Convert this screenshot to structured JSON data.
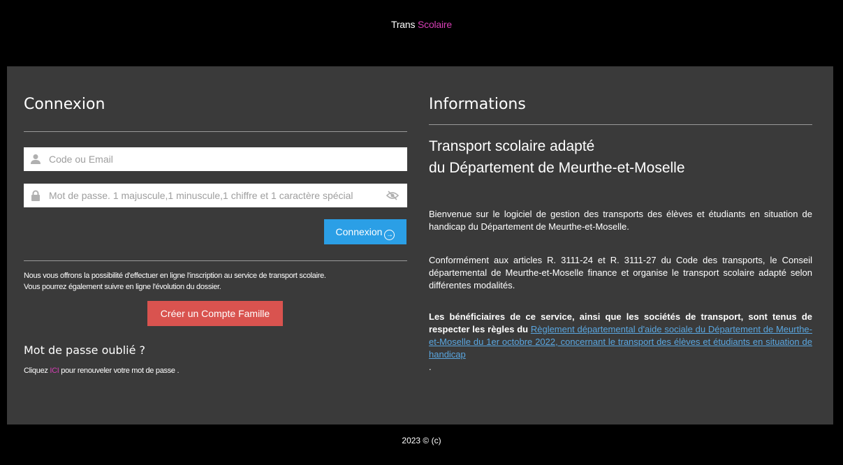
{
  "brand": {
    "word1": "Trans",
    "word2": "Scolaire"
  },
  "login": {
    "heading": "Connexion",
    "code_placeholder": "Code ou Email",
    "password_placeholder": "Mot de passe. 1 majuscule,1 minuscule,1 chiffre et 1 caractère spécial",
    "submit_label": "Connexion",
    "info_line1": "Nous vous offrons la possibilité d'effectuer en ligne l'inscription au service de transport scolaire.",
    "info_line2": "Vous pourrez également suivre en ligne l'évolution du dossier.",
    "create_account_label": "Créer un Compte Famille",
    "forgot_heading": "Mot de passe oublié ?",
    "forgot_prefix": "Cliquez",
    "forgot_link": "ICI",
    "forgot_suffix": "pour renouveler votre mot de passe ."
  },
  "info": {
    "heading": "Informations",
    "title_line1": "Transport scolaire adapté",
    "title_line2": "du Département de Meurthe-et-Moselle",
    "para1": "Bienvenue sur le logiciel de gestion des transports des élèves et étudiants en situation de handicap du Département de Meurthe-et-Moselle.",
    "para2": "Conformément aux articles R. 3111-24 et R. 3111-27 du Code des transports, le Conseil départemental de Meurthe-et-Moselle finance et organise le transport scolaire adapté selon différentes modalités.",
    "para3_bold": "Les bénéficiaires de ce service, ainsi que les sociétés de transport, sont tenus de respecter les règles du",
    "para3_link": "Règlement départemental d'aide sociale du Département de Meurthe-et-Moselle du 1er octobre 2022, concernant le transport des élèves et étudiants en situation de handicap",
    "para3_end": "."
  },
  "footer": {
    "copyright": "2023 © (c)"
  },
  "colors": {
    "accent_pink": "#d63fb5",
    "login_button": "#2b9fe6",
    "create_button": "#d9534f",
    "panel_bg": "#3a3a3a",
    "link_blue": "#5aa6df"
  },
  "icons": {
    "user": "user-icon",
    "lock": "lock-icon",
    "eye": "eye-slash-icon",
    "arrow": "arrow-circle-right-icon"
  }
}
